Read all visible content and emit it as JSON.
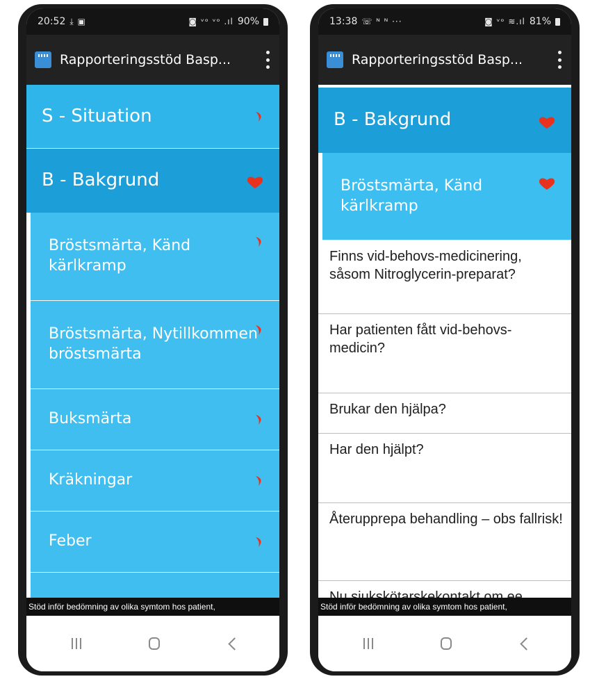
{
  "left_phone": {
    "status": {
      "time": "20:52",
      "left_icons": "⤓ ▣",
      "right_icons": "◙ ᵛᵒ ᵛᵒ .ıl",
      "battery": "90%"
    },
    "app": {
      "title": "Rapporteringsstöd Basp..."
    },
    "rows": [
      {
        "label": "S - Situation",
        "marker": "chevron-right-icon"
      },
      {
        "label": "B - Bakgrund",
        "marker": "heart-icon"
      },
      {
        "label": "Bröstsmärta, Känd kärlkramp",
        "marker": "chevron-right-icon"
      },
      {
        "label": "Bröstsmärta, Nytillkommen bröstsmärta",
        "marker": "chevron-right-icon"
      },
      {
        "label": "Buksmärta",
        "marker": "chevron-right-icon"
      },
      {
        "label": "Kräkningar",
        "marker": "chevron-right-icon"
      },
      {
        "label": "Feber",
        "marker": "chevron-right-icon"
      }
    ],
    "footer_text": "Stöd inför bedömning av olika symtom hos patient,"
  },
  "right_phone": {
    "status": {
      "time": "13:38",
      "left_icons": "☏ ᴺ ᴺ ···",
      "right_icons": "◙ ᵛᵒ ≋.ıl",
      "battery": "81%"
    },
    "app": {
      "title": "Rapporteringsstöd Basp..."
    },
    "section": {
      "label": "B - Bakgrund",
      "marker": "heart-icon"
    },
    "subsection": {
      "label": "Bröstsmärta, Känd kärlkramp",
      "marker": "heart-icon"
    },
    "questions": [
      "Finns vid-behovs-medicinering, såsom Nitroglycerin-preparat?",
      "Har patienten fått vid-behovs-medicin?",
      "Brukar den hjälpa?",
      "Har den hjälpt?",
      "Återupprepa behandling – obs fallrisk!",
      "Nu sjukskötarskekontakt om ee"
    ],
    "footer_text": "Stöd inför bedömning av olika symtom hos patient,"
  },
  "colors": {
    "accent": "#30b5ea",
    "accent_dark": "#1c9ed8",
    "marker_red": "#e8321e",
    "appbar": "#222222"
  }
}
